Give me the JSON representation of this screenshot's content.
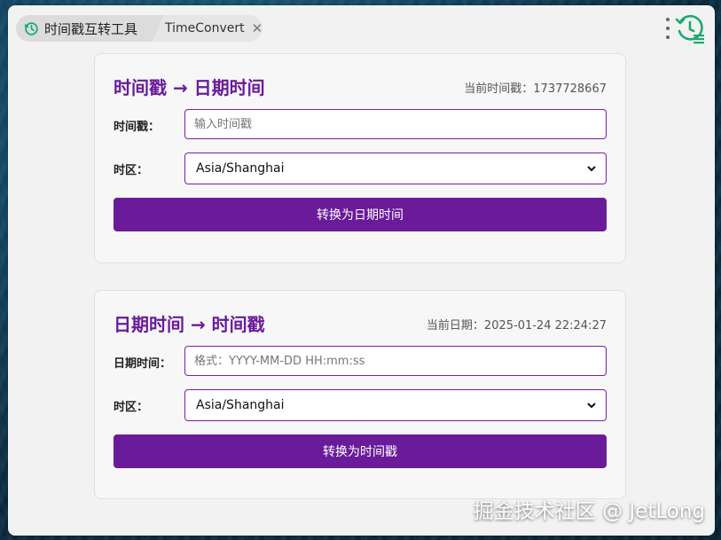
{
  "tabs": {
    "main_label": "时间戳互转工具",
    "sub_label": "TimeConvert",
    "close_glyph": "✕"
  },
  "colors": {
    "accent": "#6a1b9a",
    "icon_green": "#1aaa6f"
  },
  "card1": {
    "title": "时间戳 → 日期时间",
    "meta": "当前时间戳：1737728667",
    "timestamp_label": "时间戳：",
    "timestamp_placeholder": "输入时间戳",
    "timezone_label": "时区：",
    "timezone_value": "Asia/Shanghai",
    "button": "转换为日期时间"
  },
  "card2": {
    "title": "日期时间 → 时间戳",
    "meta": "当前日期：2025-01-24 22:24:27",
    "datetime_label": "日期时间：",
    "datetime_placeholder": "格式：YYYY-MM-DD HH:mm:ss",
    "timezone_label": "时区：",
    "timezone_value": "Asia/Shanghai",
    "button": "转换为时间戳"
  },
  "watermark": "掘金技术社区 @ JetLong",
  "icons": {
    "tab_icon": "clock-convert-icon",
    "menu": "more-vertical-icon",
    "app": "history-clock-icon",
    "dropdown": "chevron-down-icon",
    "close": "close-icon"
  }
}
